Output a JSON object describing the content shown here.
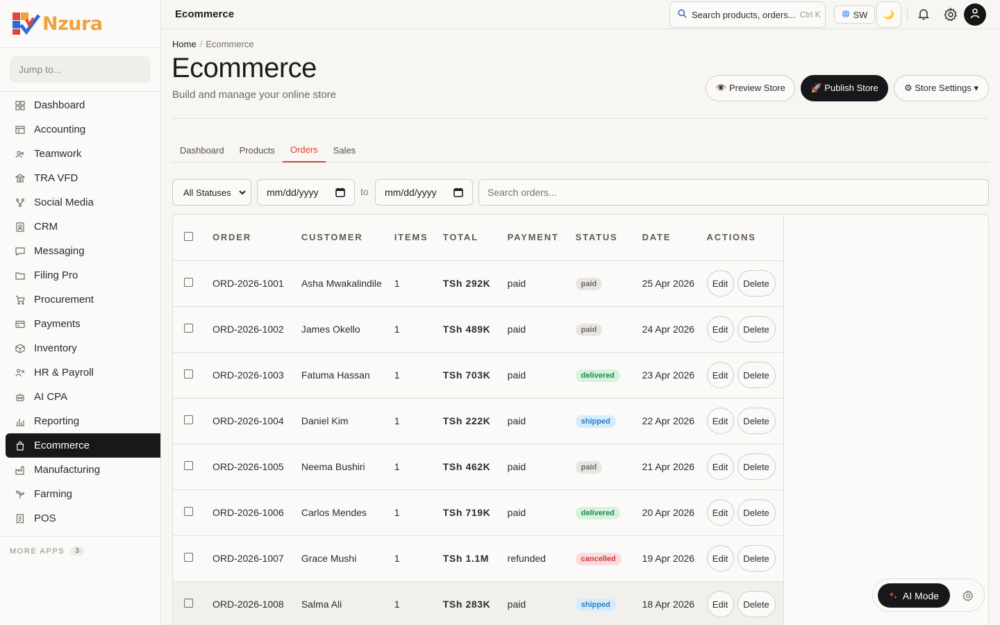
{
  "brand": {
    "name": "Nzura"
  },
  "sidebar": {
    "jump_placeholder": "Jump to...",
    "items": [
      {
        "label": "Dashboard",
        "icon": "grid-icon"
      },
      {
        "label": "Accounting",
        "icon": "ledger-icon"
      },
      {
        "label": "Teamwork",
        "icon": "team-icon"
      },
      {
        "label": "TRA VFD",
        "icon": "bank-icon"
      },
      {
        "label": "Social Media",
        "icon": "share-icon"
      },
      {
        "label": "CRM",
        "icon": "contact-icon"
      },
      {
        "label": "Messaging",
        "icon": "message-icon"
      },
      {
        "label": "Filing Pro",
        "icon": "folder-icon"
      },
      {
        "label": "Procurement",
        "icon": "cart-icon"
      },
      {
        "label": "Payments",
        "icon": "card-icon"
      },
      {
        "label": "Inventory",
        "icon": "box-icon"
      },
      {
        "label": "HR & Payroll",
        "icon": "people-icon"
      },
      {
        "label": "AI CPA",
        "icon": "robot-icon"
      },
      {
        "label": "Reporting",
        "icon": "bar-chart-icon"
      },
      {
        "label": "Ecommerce",
        "icon": "bag-icon",
        "active": true
      },
      {
        "label": "Manufacturing",
        "icon": "factory-icon"
      },
      {
        "label": "Farming",
        "icon": "sprout-icon"
      },
      {
        "label": "POS",
        "icon": "receipt-icon"
      }
    ],
    "more_apps_label": "MORE APPS",
    "more_apps_count": "3"
  },
  "topbar": {
    "title": "Ecommerce",
    "search_label": "Search products, orders...",
    "search_shortcut": "Ctrl K",
    "lang": "SW",
    "theme_icon": "🌙"
  },
  "breadcrumb": {
    "home": "Home",
    "current": "Ecommerce"
  },
  "header": {
    "title": "Ecommerce",
    "subtitle": "Build and manage your online store",
    "preview_label": "👁️ Preview Store",
    "publish_label": "🚀 Publish Store",
    "settings_label": "⚙ Store Settings ▾"
  },
  "tabs": [
    "Dashboard",
    "Products",
    "Orders",
    "Sales"
  ],
  "active_tab": "Orders",
  "filters": {
    "status_value": "All Statuses",
    "date_from_placeholder": "mm/dd/yyyy",
    "date_to_placeholder": "mm/dd/yyyy",
    "to_label": "to",
    "search_placeholder": "Search orders..."
  },
  "table": {
    "columns": [
      "ORDER",
      "CUSTOMER",
      "ITEMS",
      "TOTAL",
      "PAYMENT",
      "STATUS",
      "DATE",
      "ACTIONS"
    ],
    "edit_label": "Edit",
    "delete_label": "Delete",
    "rows": [
      {
        "order": "ORD-2026-1001",
        "customer": "Asha Mwakalindile",
        "items": "1",
        "total": "TSh 292K",
        "payment": "paid",
        "status": "paid",
        "date": "25 Apr 2026"
      },
      {
        "order": "ORD-2026-1002",
        "customer": "James Okello",
        "items": "1",
        "total": "TSh 489K",
        "payment": "paid",
        "status": "paid",
        "date": "24 Apr 2026"
      },
      {
        "order": "ORD-2026-1003",
        "customer": "Fatuma Hassan",
        "items": "1",
        "total": "TSh 703K",
        "payment": "paid",
        "status": "delivered",
        "date": "23 Apr 2026"
      },
      {
        "order": "ORD-2026-1004",
        "customer": "Daniel Kim",
        "items": "1",
        "total": "TSh 222K",
        "payment": "paid",
        "status": "shipped",
        "date": "22 Apr 2026"
      },
      {
        "order": "ORD-2026-1005",
        "customer": "Neema Bushiri",
        "items": "1",
        "total": "TSh 462K",
        "payment": "paid",
        "status": "paid",
        "date": "21 Apr 2026"
      },
      {
        "order": "ORD-2026-1006",
        "customer": "Carlos Mendes",
        "items": "1",
        "total": "TSh 719K",
        "payment": "paid",
        "status": "delivered",
        "date": "20 Apr 2026"
      },
      {
        "order": "ORD-2026-1007",
        "customer": "Grace Mushi",
        "items": "1",
        "total": "TSh 1.1M",
        "payment": "refunded",
        "status": "cancelled",
        "date": "19 Apr 2026"
      },
      {
        "order": "ORD-2026-1008",
        "customer": "Salma Ali",
        "items": "1",
        "total": "TSh 283K",
        "payment": "paid",
        "status": "shipped",
        "date": "18 Apr 2026"
      }
    ]
  },
  "ai": {
    "label": "AI Mode"
  },
  "colors": {
    "accent": "#d9452b",
    "dark": "#17181a",
    "logo_orange": "#f0a23b"
  }
}
